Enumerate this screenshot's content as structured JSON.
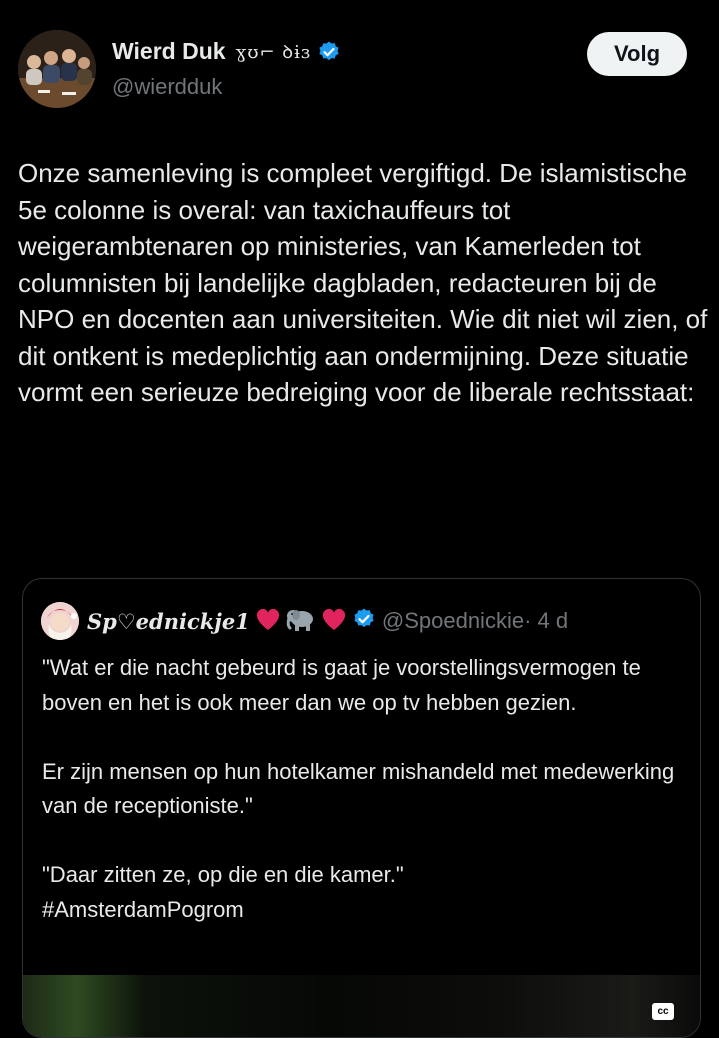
{
  "author": {
    "display_name": "Wierd Duk",
    "name_suffix": "ɣʊ⌐ ꝺɨɜ",
    "handle": "@wierdduk",
    "verified": true,
    "avatar_icon": "group-photo-avatar"
  },
  "follow_button": {
    "label": "Volg"
  },
  "tweet": {
    "text": "Onze samenleving is compleet vergiftigd. De islamistische 5e colonne is overal: van taxichauffeurs tot weigerambtenaren op ministeries, van Kamerleden tot columnisten bij landelijke dagbladen, redacteuren bij de NPO en docenten aan universiteiten. Wie dit niet wil zien, of dit ontkent is medeplichtig aan ondermijning. Deze situatie vormt een serieuze bedreiging voor de liberale rechtsstaat:"
  },
  "quote": {
    "display_name": "Sp♡ednickje1",
    "emojis": [
      "red-heart",
      "elephant",
      "red-heart"
    ],
    "verified": true,
    "handle": "@Spoednickie",
    "time": "· 4 d",
    "paragraphs": [
      "\"Wat er die nacht gebeurd is gaat je voorstellingsvermogen te boven en het is ook meer dan we op tv hebben gezien.",
      "Er zijn mensen op hun hotelkamer mishandeld met medewerking van de receptioniste.\"",
      "\"Daar zitten ze, op die en die kamer.\"\n#AmsterdamPogrom"
    ],
    "media_badge": "cc"
  },
  "colors": {
    "background": "#000000",
    "text": "#e7e9ea",
    "muted": "#71767b",
    "verified_blue": "#1d9bf0",
    "border": "#2f3336",
    "heart_red": "#e0245e"
  }
}
